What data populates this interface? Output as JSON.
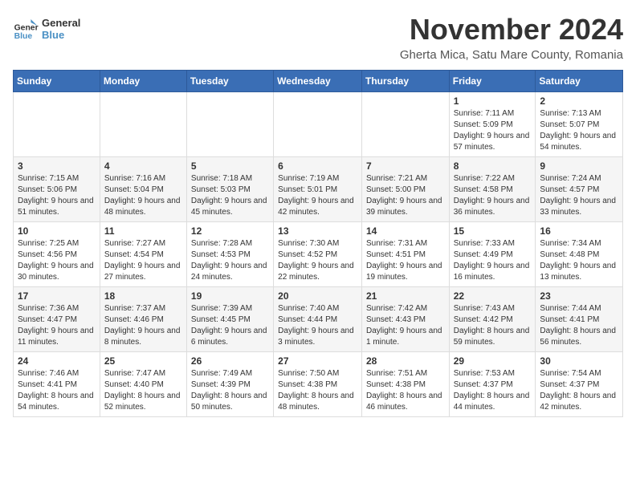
{
  "logo": {
    "line1": "General",
    "line2": "Blue"
  },
  "title": "November 2024",
  "subtitle": "Gherta Mica, Satu Mare County, Romania",
  "days_of_week": [
    "Sunday",
    "Monday",
    "Tuesday",
    "Wednesday",
    "Thursday",
    "Friday",
    "Saturday"
  ],
  "weeks": [
    [
      {
        "day": "",
        "info": ""
      },
      {
        "day": "",
        "info": ""
      },
      {
        "day": "",
        "info": ""
      },
      {
        "day": "",
        "info": ""
      },
      {
        "day": "",
        "info": ""
      },
      {
        "day": "1",
        "info": "Sunrise: 7:11 AM\nSunset: 5:09 PM\nDaylight: 9 hours and 57 minutes."
      },
      {
        "day": "2",
        "info": "Sunrise: 7:13 AM\nSunset: 5:07 PM\nDaylight: 9 hours and 54 minutes."
      }
    ],
    [
      {
        "day": "3",
        "info": "Sunrise: 7:15 AM\nSunset: 5:06 PM\nDaylight: 9 hours and 51 minutes."
      },
      {
        "day": "4",
        "info": "Sunrise: 7:16 AM\nSunset: 5:04 PM\nDaylight: 9 hours and 48 minutes."
      },
      {
        "day": "5",
        "info": "Sunrise: 7:18 AM\nSunset: 5:03 PM\nDaylight: 9 hours and 45 minutes."
      },
      {
        "day": "6",
        "info": "Sunrise: 7:19 AM\nSunset: 5:01 PM\nDaylight: 9 hours and 42 minutes."
      },
      {
        "day": "7",
        "info": "Sunrise: 7:21 AM\nSunset: 5:00 PM\nDaylight: 9 hours and 39 minutes."
      },
      {
        "day": "8",
        "info": "Sunrise: 7:22 AM\nSunset: 4:58 PM\nDaylight: 9 hours and 36 minutes."
      },
      {
        "day": "9",
        "info": "Sunrise: 7:24 AM\nSunset: 4:57 PM\nDaylight: 9 hours and 33 minutes."
      }
    ],
    [
      {
        "day": "10",
        "info": "Sunrise: 7:25 AM\nSunset: 4:56 PM\nDaylight: 9 hours and 30 minutes."
      },
      {
        "day": "11",
        "info": "Sunrise: 7:27 AM\nSunset: 4:54 PM\nDaylight: 9 hours and 27 minutes."
      },
      {
        "day": "12",
        "info": "Sunrise: 7:28 AM\nSunset: 4:53 PM\nDaylight: 9 hours and 24 minutes."
      },
      {
        "day": "13",
        "info": "Sunrise: 7:30 AM\nSunset: 4:52 PM\nDaylight: 9 hours and 22 minutes."
      },
      {
        "day": "14",
        "info": "Sunrise: 7:31 AM\nSunset: 4:51 PM\nDaylight: 9 hours and 19 minutes."
      },
      {
        "day": "15",
        "info": "Sunrise: 7:33 AM\nSunset: 4:49 PM\nDaylight: 9 hours and 16 minutes."
      },
      {
        "day": "16",
        "info": "Sunrise: 7:34 AM\nSunset: 4:48 PM\nDaylight: 9 hours and 13 minutes."
      }
    ],
    [
      {
        "day": "17",
        "info": "Sunrise: 7:36 AM\nSunset: 4:47 PM\nDaylight: 9 hours and 11 minutes."
      },
      {
        "day": "18",
        "info": "Sunrise: 7:37 AM\nSunset: 4:46 PM\nDaylight: 9 hours and 8 minutes."
      },
      {
        "day": "19",
        "info": "Sunrise: 7:39 AM\nSunset: 4:45 PM\nDaylight: 9 hours and 6 minutes."
      },
      {
        "day": "20",
        "info": "Sunrise: 7:40 AM\nSunset: 4:44 PM\nDaylight: 9 hours and 3 minutes."
      },
      {
        "day": "21",
        "info": "Sunrise: 7:42 AM\nSunset: 4:43 PM\nDaylight: 9 hours and 1 minute."
      },
      {
        "day": "22",
        "info": "Sunrise: 7:43 AM\nSunset: 4:42 PM\nDaylight: 8 hours and 59 minutes."
      },
      {
        "day": "23",
        "info": "Sunrise: 7:44 AM\nSunset: 4:41 PM\nDaylight: 8 hours and 56 minutes."
      }
    ],
    [
      {
        "day": "24",
        "info": "Sunrise: 7:46 AM\nSunset: 4:41 PM\nDaylight: 8 hours and 54 minutes."
      },
      {
        "day": "25",
        "info": "Sunrise: 7:47 AM\nSunset: 4:40 PM\nDaylight: 8 hours and 52 minutes."
      },
      {
        "day": "26",
        "info": "Sunrise: 7:49 AM\nSunset: 4:39 PM\nDaylight: 8 hours and 50 minutes."
      },
      {
        "day": "27",
        "info": "Sunrise: 7:50 AM\nSunset: 4:38 PM\nDaylight: 8 hours and 48 minutes."
      },
      {
        "day": "28",
        "info": "Sunrise: 7:51 AM\nSunset: 4:38 PM\nDaylight: 8 hours and 46 minutes."
      },
      {
        "day": "29",
        "info": "Sunrise: 7:53 AM\nSunset: 4:37 PM\nDaylight: 8 hours and 44 minutes."
      },
      {
        "day": "30",
        "info": "Sunrise: 7:54 AM\nSunset: 4:37 PM\nDaylight: 8 hours and 42 minutes."
      }
    ]
  ]
}
